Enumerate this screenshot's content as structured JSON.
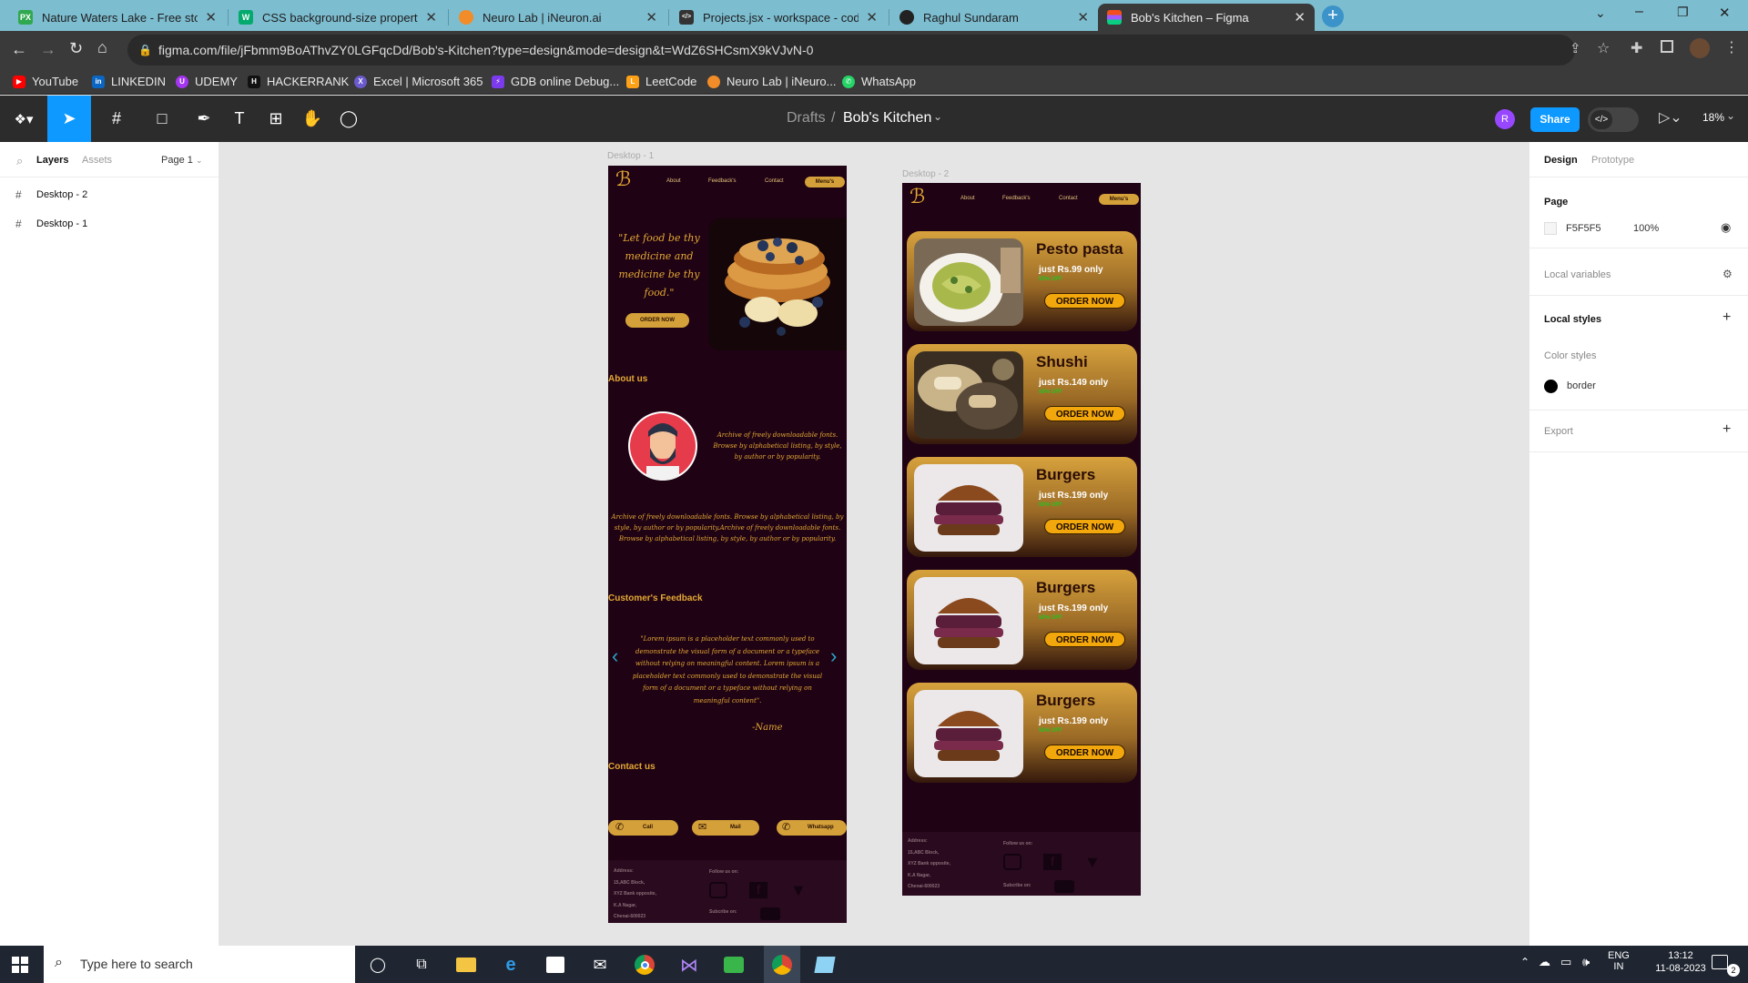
{
  "browser": {
    "tabs": [
      {
        "title": "Nature Waters Lake - Free stock",
        "favicon": "px-icon",
        "color": "#2fa84f",
        "glyph": "PX"
      },
      {
        "title": "CSS background-size property",
        "favicon": "w3schools-icon",
        "color": "#04aa6d",
        "glyph": "W"
      },
      {
        "title": "Neuro Lab | iNeuron.ai",
        "favicon": "ineuron-icon",
        "color": "#f28c28",
        "glyph": ""
      },
      {
        "title": "Projects.jsx - workspace - code-s",
        "favicon": "code-icon",
        "color": "#333333",
        "glyph": "</>"
      },
      {
        "title": "Raghul Sundaram",
        "favicon": "github-icon",
        "color": "#222222",
        "glyph": ""
      },
      {
        "title": "Bob's Kitchen – Figma",
        "favicon": "figma-icon",
        "color": "#f24e1e",
        "glyph": ""
      }
    ],
    "url": "figma.com/file/jFbmm9BoAThvZY0LGFqcDd/Bob's-Kitchen?type=design&mode=design&t=WdZ6SHCsmX9kVJvN-0",
    "bookmarks": [
      {
        "label": "YouTube",
        "color": "#ff0000",
        "glyph": "▶"
      },
      {
        "label": "LINKEDIN",
        "color": "#0a66c2",
        "glyph": "in"
      },
      {
        "label": "UDEMY",
        "color": "#a435f0",
        "glyph": "U"
      },
      {
        "label": "HACKERRANK",
        "color": "#1ba94c",
        "glyph": "H"
      },
      {
        "label": "Excel | Microsoft 365",
        "color": "#6a5acd",
        "glyph": "X"
      },
      {
        "label": "GDB online Debug...",
        "color": "#7c3aed",
        "glyph": "⚡"
      },
      {
        "label": "LeetCode",
        "color": "#ffa116",
        "glyph": "L"
      },
      {
        "label": "Neuro Lab | iNeuro...",
        "color": "#f28c28",
        "glyph": ""
      },
      {
        "label": "WhatsApp",
        "color": "#25d366",
        "glyph": "✆"
      }
    ]
  },
  "figma": {
    "breadcrumb_parent": "Drafts",
    "breadcrumb_sep": "/",
    "file_name": "Bob's Kitchen",
    "avatar_initial": "R",
    "share_label": "Share",
    "zoom": "18%"
  },
  "left_panel": {
    "tabs": [
      "Layers",
      "Assets"
    ],
    "page": "Page 1",
    "layers": [
      "Desktop - 2",
      "Desktop - 1"
    ]
  },
  "right_panel": {
    "tabs": [
      "Design",
      "Prototype"
    ],
    "page_title": "Page",
    "page_color": "F5F5F5",
    "page_opacity": "100%",
    "local_variables": "Local variables",
    "local_styles": "Local styles",
    "color_styles": "Color styles",
    "color_style_name": "border",
    "export": "Export"
  },
  "canvas": {
    "desktop1": {
      "label": "Desktop - 1",
      "nav": [
        "About",
        "Feedback's",
        "Contact",
        "Menu's"
      ],
      "quote": "\"Let food be thy medicine and medicine be thy food.\"",
      "order_now": "ORDER NOW",
      "about_heading": "About us",
      "about_short": "Archive of freely downloadable fonts. Browse by alphabetical listing, by style, by author or by popularity.",
      "about_long": "Archive of freely downloadable fonts. Browse by alphabetical listing, by style, by author or by popularity.Archive of freely downloadable fonts. Browse by alphabetical listing, by style, by author or by popularity.",
      "feedback_heading": "Customer's Feedback",
      "feedback_text": "\"Lorem ipsum is a placeholder text commonly used to demonstrate the visual form of a document or a typeface without relying on meaningful content. Lorem ipsum is a placeholder text commonly used to demonstrate the visual form of a document or a typeface without relying on meaningful content\".",
      "feedback_name": "-Name",
      "contact_heading": "Contact us",
      "contact_buttons": [
        "Call",
        "Mail",
        "Whatsapp"
      ],
      "footer_address": [
        "Address:",
        "15,ABC Block,",
        "XYZ Bank opposite,",
        "K.A Nagar,",
        "Chenai-600023"
      ],
      "follow_us": "Follow us on:",
      "subscribe": "Subcribe on:"
    },
    "desktop2": {
      "label": "Desktop - 2",
      "nav": [
        "About",
        "Feedback's",
        "Contact",
        "Menu's"
      ],
      "cards": [
        {
          "title": "Pesto pasta",
          "price": "just Rs.99  only",
          "off": "50% OFF",
          "button": "ORDER NOW",
          "image": "pasta"
        },
        {
          "title": "Shushi",
          "price": "just Rs.149  only",
          "off": "50% OFF",
          "button": "ORDER NOW",
          "image": "sushi"
        },
        {
          "title": "Burgers",
          "price": "just Rs.199  only",
          "off": "50% OFF",
          "button": "ORDER NOW",
          "image": "burger"
        },
        {
          "title": "Burgers",
          "price": "just Rs.199  only",
          "off": "50% OFF",
          "button": "ORDER NOW",
          "image": "burger"
        },
        {
          "title": "Burgers",
          "price": "just Rs.199  only",
          "off": "50% OFF",
          "button": "ORDER NOW",
          "image": "burger"
        }
      ],
      "footer_address": [
        "Address:",
        "15,ABC Block,",
        "XYZ Bank opposite,",
        "K.A Nagar,",
        "Chenai-600023"
      ],
      "follow_us": "Follow us on:",
      "subscribe": "Subcribe on:"
    }
  },
  "taskbar": {
    "search_placeholder": "Type here to search",
    "lang": "ENG",
    "region": "IN",
    "time": "13:12",
    "date": "11-08-2023",
    "notifications": "2"
  },
  "help_label": "?"
}
